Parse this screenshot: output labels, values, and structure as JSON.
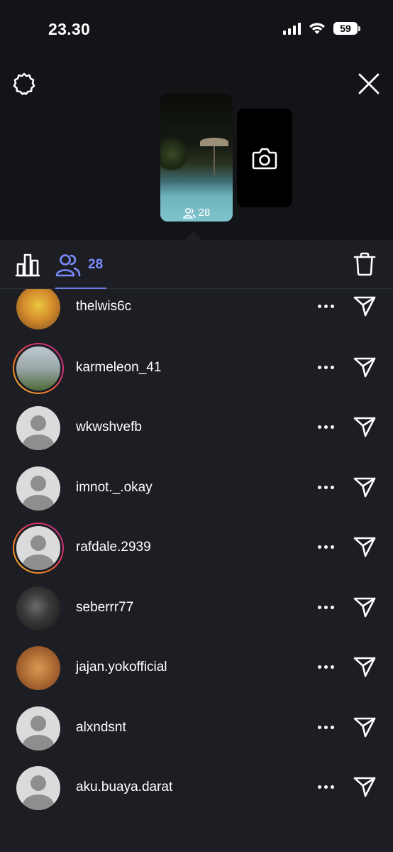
{
  "status_bar": {
    "time": "23.30",
    "battery": "59"
  },
  "story": {
    "viewer_count": "28"
  },
  "tabs": {
    "viewers_count": "28"
  },
  "viewers": [
    {
      "username": "thelwis6c",
      "avatar": "photo1",
      "ring": false
    },
    {
      "username": "karmeleon_41",
      "avatar": "photo2",
      "ring": true
    },
    {
      "username": "wkwshvefb",
      "avatar": "default",
      "ring": false
    },
    {
      "username": "imnot._.okay",
      "avatar": "default",
      "ring": false
    },
    {
      "username": "rafdale.2939",
      "avatar": "default",
      "ring": true
    },
    {
      "username": "seberrr77",
      "avatar": "photo3",
      "ring": false
    },
    {
      "username": "jajan.yokofficial",
      "avatar": "photo4",
      "ring": false
    },
    {
      "username": "alxndsnt",
      "avatar": "default",
      "ring": false
    },
    {
      "username": "aku.buaya.darat",
      "avatar": "default",
      "ring": false
    }
  ],
  "colors": {
    "accent": "#7b8cff",
    "background": "#1c1e23",
    "header_bg": "#121418"
  },
  "icons": [
    "gear-icon",
    "close-icon",
    "camera-icon",
    "bar-chart-icon",
    "viewers-icon",
    "trash-icon",
    "more-icon",
    "send-icon"
  ]
}
